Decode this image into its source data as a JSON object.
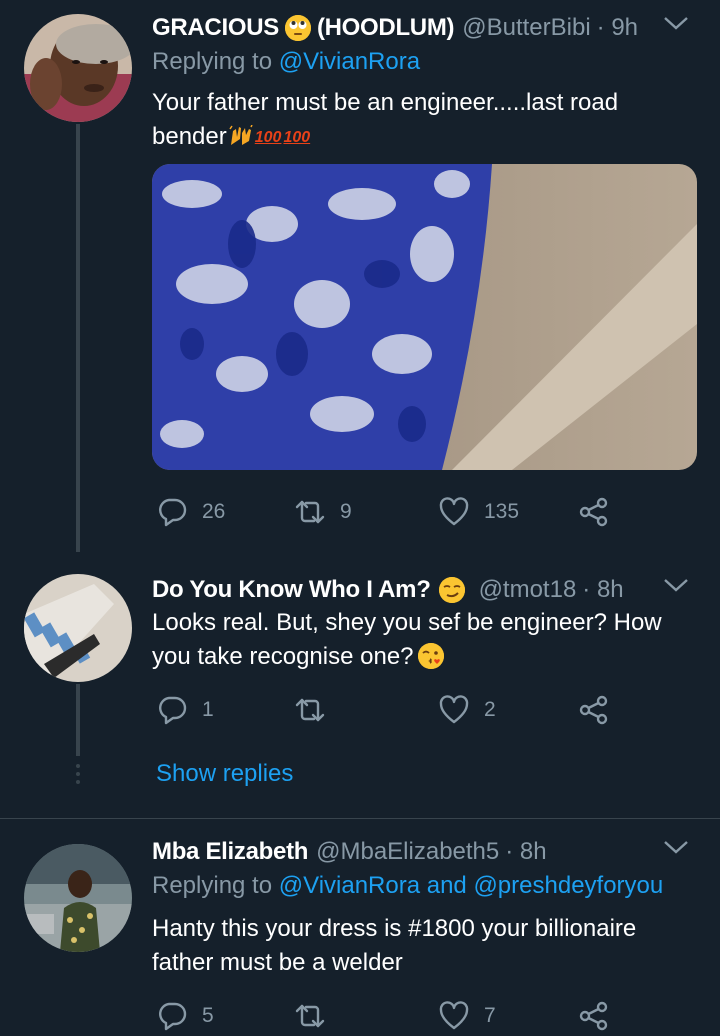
{
  "tweets": [
    {
      "name": "GRACIOUS",
      "name_suffix": "(HOODLUM)",
      "handle": "@ButterBibi",
      "time": "· 9h",
      "reply_prefix": "Replying to",
      "reply_mentions": "@VivianRora",
      "text_line1": "Your father must be an engineer.....last road",
      "text_line2": "bender",
      "emoji_100": "100",
      "reply_count": "26",
      "retweet_count": "9",
      "like_count": "135"
    },
    {
      "name": "Do You Know Who I Am?",
      "handle": "@tmot18",
      "time": "· 8h",
      "text_line1": "Looks real. But, shey you sef be engineer? How",
      "text_line2": "you take recognise one?",
      "reply_count": "1",
      "retweet_count": "",
      "like_count": "2"
    },
    {
      "name": "Mba Elizabeth",
      "handle": "@MbaElizabeth5",
      "time": "· 8h",
      "reply_prefix": "Replying to",
      "reply_mentions": "@VivianRora and @preshdeyforyou",
      "text_line1": "Hanty this your dress is #1800 your billionaire",
      "text_line2": "father must be a welder",
      "reply_count": "5",
      "retweet_count": "",
      "like_count": "7"
    }
  ],
  "show_replies_label": "Show replies",
  "icons": {
    "reply": "reply-icon",
    "retweet": "retweet-icon",
    "like": "heart-icon",
    "share": "share-icon",
    "caret": "chevron-down-icon"
  },
  "colors": {
    "background": "#15202b",
    "secondary_text": "#8899a6",
    "accent": "#1da1f2",
    "divider": "#38444d"
  }
}
